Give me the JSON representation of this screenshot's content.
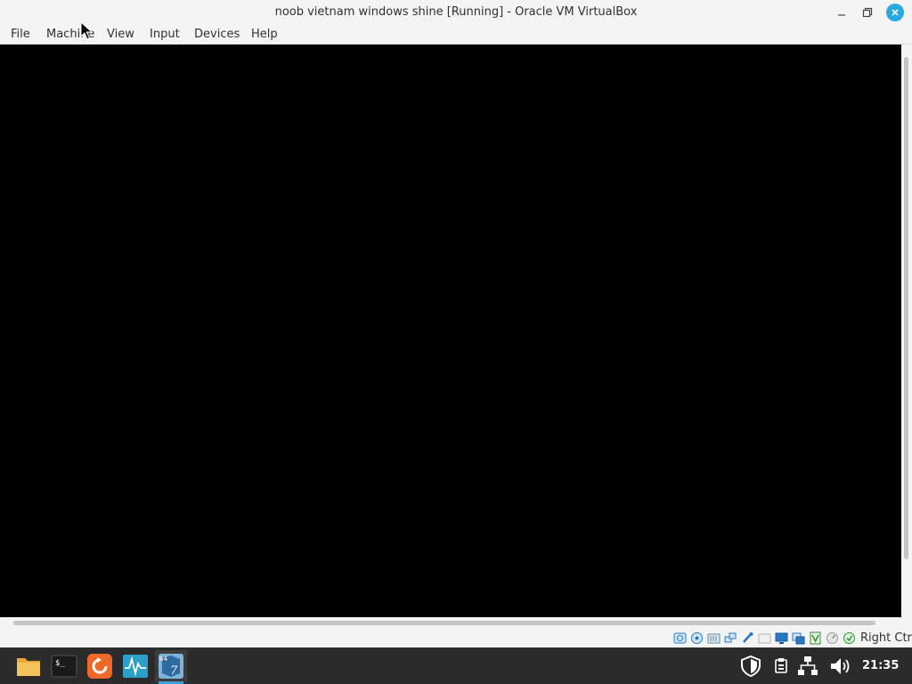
{
  "window": {
    "title": "noob vietnam windows shine [Running] - Oracle VM VirtualBox",
    "controls": [
      "minimize-icon",
      "restore-icon",
      "close-icon"
    ],
    "accent": "#2aa7e0"
  },
  "menubar": {
    "file": "File",
    "machine": "Machine",
    "view": "View",
    "input": "Input",
    "devices": "Devices",
    "help": "Help"
  },
  "vm_display": {
    "background": "#000000"
  },
  "statusbar": {
    "icons": [
      "hard-disk-icon",
      "optical-drive-icon",
      "audio-icon",
      "network-icon",
      "usb-icon",
      "shared-folders-icon",
      "display-icon",
      "video-capture-icon",
      "graphics-acceleration-icon",
      "cpu-icon",
      "mouse-integration-icon",
      "keyboard-capture-icon"
    ],
    "host_key": "Right Ctrl"
  },
  "taskbar": {
    "apps": [
      "file-manager-icon",
      "terminal-icon",
      "update-manager-icon",
      "system-monitor-icon",
      "virtualbox-icon"
    ],
    "tray": [
      "shield-icon",
      "clipboard-icon",
      "network-icon",
      "volume-icon"
    ],
    "clock": "21:35",
    "background": "#2b2b2b"
  }
}
